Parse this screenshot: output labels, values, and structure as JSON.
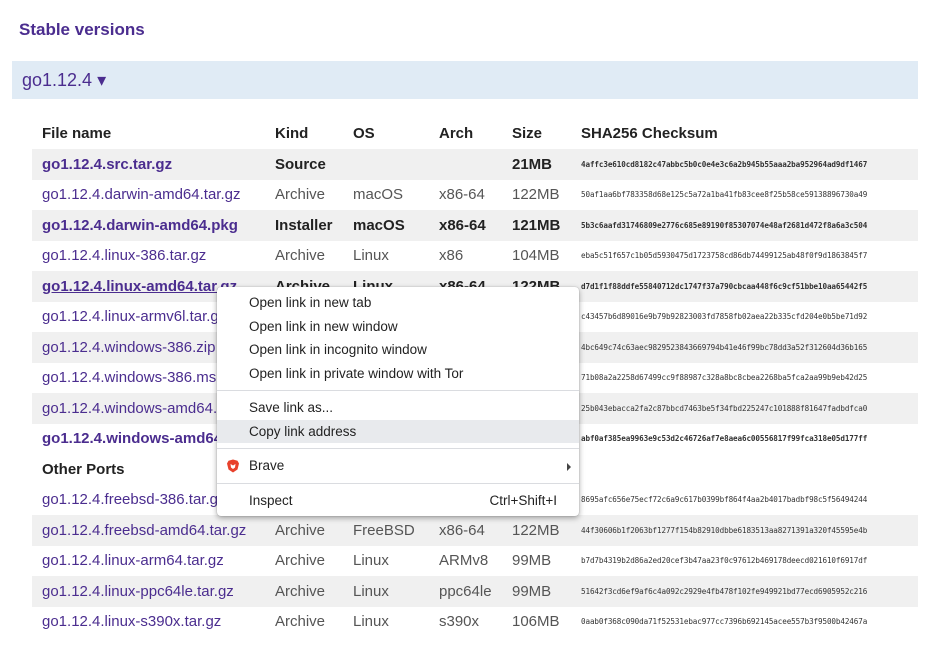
{
  "page": {
    "section_title": "Stable versions",
    "version_label": "go1.12.4 ▾"
  },
  "table": {
    "headers": [
      "File name",
      "Kind",
      "OS",
      "Arch",
      "Size",
      "SHA256 Checksum"
    ],
    "rows": [
      {
        "name": "go1.12.4.src.tar.gz",
        "kind": "Source",
        "os": "",
        "arch": "",
        "size": "21MB",
        "sum": "4affc3e610cd8182c47abbc5b0c0e4e3c6a2b945b55aaa2ba952964ad9df1467"
      },
      {
        "name": "go1.12.4.darwin-amd64.tar.gz",
        "kind": "Archive",
        "os": "macOS",
        "arch": "x86-64",
        "size": "122MB",
        "sum": "50af1aa6bf783358d68e125c5a72a1ba41fb83cee8f25b58ce59138896730a49"
      },
      {
        "name": "go1.12.4.darwin-amd64.pkg",
        "kind": "Installer",
        "os": "macOS",
        "arch": "x86-64",
        "size": "121MB",
        "sum": "5b3c6aafd31746809e2776c685e89190f85307074e48af2681d472f8a6a3c504"
      },
      {
        "name": "go1.12.4.linux-386.tar.gz",
        "kind": "Archive",
        "os": "Linux",
        "arch": "x86",
        "size": "104MB",
        "sum": "eba5c51f657c1b05d5930475d1723758cd86db74499125ab48f0f9d1863845f7"
      },
      {
        "name": "go1.12.4.linux-amd64.tar.gz",
        "kind": "Archive",
        "os": "Linux",
        "arch": "x86-64",
        "size": "122MB",
        "sum": "d7d1f1f88ddfe55840712dc1747f37a790cbcaa448f6c9cf51bbe10aa65442f5"
      },
      {
        "name": "go1.12.4.linux-armv6l.tar.gz",
        "kind": "",
        "os": "",
        "arch": "",
        "size": "",
        "sum": "c43457b6d89016e9b79b92823003fd7858fb02aea22b335cfd204e0b5be71d92"
      },
      {
        "name": "go1.12.4.windows-386.zip",
        "kind": "",
        "os": "",
        "arch": "",
        "size": "",
        "sum": "4bc649c74c63aec9829523843669794b41e46f99bc78dd3a52f312604d36b165"
      },
      {
        "name": "go1.12.4.windows-386.msi",
        "kind": "",
        "os": "",
        "arch": "",
        "size": "",
        "sum": "71b08a2a2258d67499cc9f88987c328a8bc8cbea2268ba5fca2aa99b9eb42d25"
      },
      {
        "name": "go1.12.4.windows-amd64.zip",
        "kind": "",
        "os": "",
        "arch": "",
        "size": "",
        "sum": "25b043ebacca2fa2c87bbcd7463be5f34fbd225247c101888f81647fadbdfca0"
      },
      {
        "name": "go1.12.4.windows-amd64.msi",
        "kind": "",
        "os": "",
        "arch": "",
        "size": "",
        "sum": "abf0af385ea9963e9c53d2c46726af7e8aea6c00556817f99fca318e05d177ff"
      }
    ],
    "other_ports_label": "Other Ports",
    "other_rows": [
      {
        "name": "go1.12.4.freebsd-386.tar.gz",
        "kind": "",
        "os": "",
        "arch": "",
        "size": "",
        "sum": "8695afc656e75ecf72c6a9c617b0399bf864f4aa2b4017badbf98c5f56494244"
      },
      {
        "name": "go1.12.4.freebsd-amd64.tar.gz",
        "kind": "Archive",
        "os": "FreeBSD",
        "arch": "x86-64",
        "size": "122MB",
        "sum": "44f30606b1f2063bf1277f154b82910dbbe6183513aa8271391a320f45595e4b"
      },
      {
        "name": "go1.12.4.linux-arm64.tar.gz",
        "kind": "Archive",
        "os": "Linux",
        "arch": "ARMv8",
        "size": "99MB",
        "sum": "b7d7b4319b2d86a2ed20cef3b47aa23f0c97612b469178deecd021610f6917df"
      },
      {
        "name": "go1.12.4.linux-ppc64le.tar.gz",
        "kind": "Archive",
        "os": "Linux",
        "arch": "ppc64le",
        "size": "99MB",
        "sum": "51642f3cd6ef9af6c4a092c2929e4fb478f102fe949921bd77ecd6905952c216"
      },
      {
        "name": "go1.12.4.linux-s390x.tar.gz",
        "kind": "Archive",
        "os": "Linux",
        "arch": "s390x",
        "size": "106MB",
        "sum": "0aab0f368c090da71f52531ebac977cc7396b692145acee557b3f9500b42467a"
      }
    ]
  },
  "context_menu": {
    "open_new_tab": "Open link in new tab",
    "open_new_window": "Open link in new window",
    "open_incognito": "Open link in incognito window",
    "open_tor": "Open link in private window with Tor",
    "save_link": "Save link as...",
    "copy_link": "Copy link address",
    "brave": "Brave",
    "inspect": "Inspect",
    "inspect_shortcut": "Ctrl+Shift+I"
  },
  "colors": {
    "link": "#4b2d8f",
    "version_bar": "#e0ebf5",
    "stripe": "#f0f0f0",
    "brave_accent": "#e8412c"
  }
}
